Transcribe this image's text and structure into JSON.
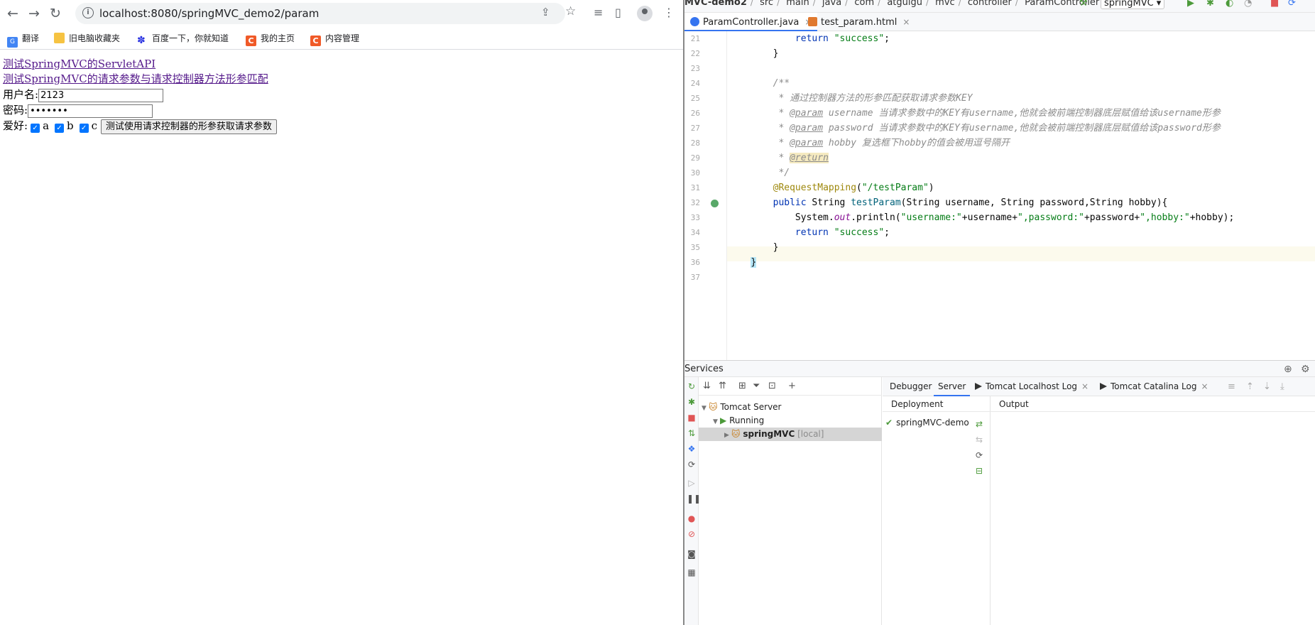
{
  "browser": {
    "url": "localhost:8080/springMVC_demo2/param",
    "bookmarks": [
      "翻译",
      "旧电脑收藏夹",
      "百度一下，你就知道",
      "我的主页",
      "内容管理"
    ],
    "links": [
      "测试SpringMVC的ServletAPI",
      "测试SpringMVC的请求参数与请求控制器方法形参匹配"
    ],
    "form": {
      "username_label": "用户名:",
      "username_value": "2123",
      "password_label": "密码:",
      "password_value": "•••••••",
      "hobby_label": "爱好:",
      "hobbies": [
        "a",
        "b",
        "c"
      ],
      "submit_label": "测试使用请求控制器的形参获取请求参数"
    }
  },
  "ide": {
    "breadcrumbs": [
      "MVC-demo2",
      "src",
      "main",
      "java",
      "com",
      "atguigu",
      "mvc",
      "controller",
      "ParamController"
    ],
    "run_config": "springMVC",
    "tabs": [
      "ParamController.java",
      "test_param.html"
    ],
    "line_numbers": [
      "21",
      "22",
      "23",
      "24",
      "25",
      "26",
      "27",
      "28",
      "29",
      "30",
      "31",
      "32",
      "33",
      "34",
      "35",
      "36",
      "37"
    ],
    "code": {
      "l21_kw": "return",
      "l21_str": "\"success\"",
      "l21_end": ";",
      "l22": "}",
      "l24": "/**",
      "l25": " * 通过控制器方法的形参匹配获取请求参数KEY",
      "l26_tag": "@param",
      "l26_rest": " username 当请求参数中的KEY有username,他就会被前端控制器底层赋值给该username形参",
      "l27_tag": "@param",
      "l27_rest": " password 当请求参数中的KEY有username,他就会被前端控制器底层赋值给该password形参",
      "l28_tag": "@param",
      "l28_rest": " hobby 复选框下hobby的值会被用逗号隔开",
      "l29_tag": "@return",
      "l30": " */",
      "l31_ann": "@RequestMapping",
      "l31_open": "(",
      "l31_str": "\"/testParam\"",
      "l31_close": ")",
      "l32_kw": "public",
      "l32_type": " String ",
      "l32_fn": "testParam",
      "l32_rest": "(String username, String password,String hobby){",
      "l33_a": "System.",
      "l33_fld": "out",
      "l33_b": ".println(",
      "l33_s1": "\"username:\"",
      "l33_c": "+username+",
      "l33_s2": "\",password:\"",
      "l33_d": "+password+",
      "l33_s3": "\",hobby:\"",
      "l33_e": "+hobby);",
      "l34_kw": "return",
      "l34_str": "\"success\"",
      "l34_end": ";",
      "l35": "}",
      "l36": "}"
    },
    "services": {
      "title": "Services",
      "tree": {
        "server": "Tomcat Server",
        "state": "Running",
        "app": "springMVC",
        "app_suffix": "[local]"
      },
      "tabs": [
        "Debugger",
        "Server",
        "Tomcat Localhost Log",
        "Tomcat Catalina Log"
      ],
      "deployment_header": "Deployment",
      "output_header": "Output",
      "deployment_item": "springMVC-demo"
    }
  },
  "colors": {
    "link": "#551a8b",
    "checkbox": "#0075ff",
    "keyword": "#0033b3",
    "string": "#067d17",
    "accent": "#3574f0"
  }
}
